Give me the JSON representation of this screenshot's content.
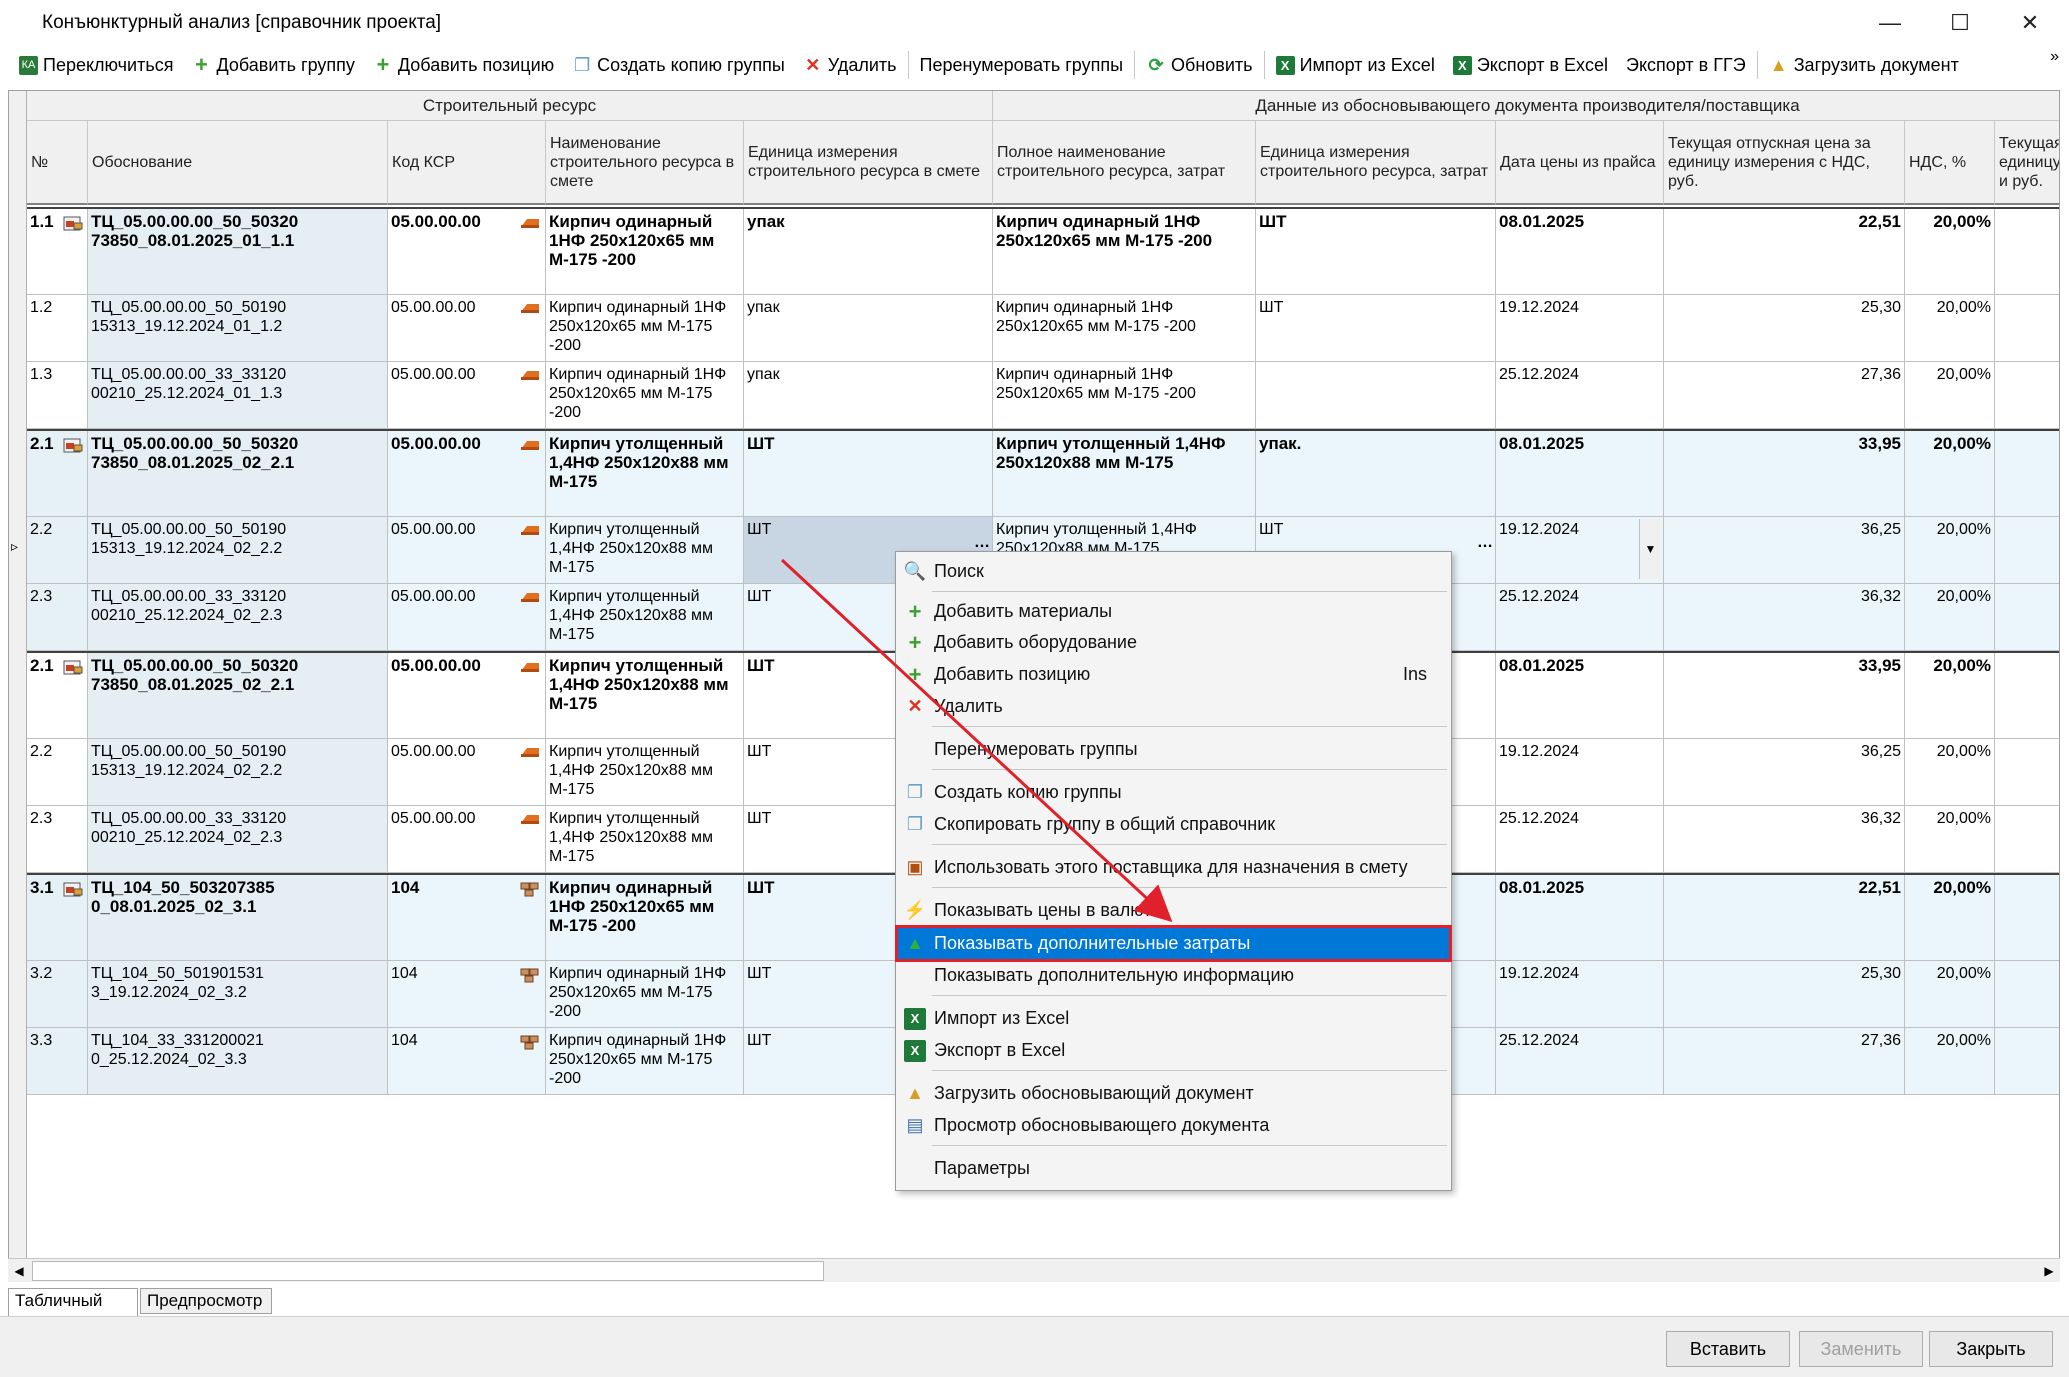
{
  "window": {
    "title": "Конъюнктурный анализ [справочник проекта]"
  },
  "toolbar": {
    "switch": "Переключиться",
    "add_group": "Добавить группу",
    "add_position": "Добавить позицию",
    "copy_group": "Создать копию группы",
    "delete": "Удалить",
    "renumber": "Перенумеровать группы",
    "refresh": "Обновить",
    "import_excel": "Импорт из Excel",
    "export_excel": "Экспорт в Excel",
    "export_gge": "Экспорт в ГГЭ",
    "load_doc": "Загрузить документ",
    "more": "»"
  },
  "grid": {
    "bands": {
      "resource": "Строительный ресурс",
      "doc_data": "Данные из обосновывающего документа производителя/поставщика"
    },
    "columns": {
      "num": "№",
      "basis": "Обоснование",
      "ksr": "Код КСР",
      "name": "Наименование строительного ресурса в смете",
      "unit": "Единица измерения строительного ресурса в смете",
      "fullname": "Полное наименование строительного ресурса, затрат",
      "unit2": "Единица измерения строительного ресурса, затрат",
      "date": "Дата цены из прайса",
      "price": "Текущая отпускная цена за единицу измерения с НДС, руб.",
      "vat": "НДС, %",
      "cur": "Текущая единицу и руб."
    },
    "rows": [
      {
        "num": "1.1",
        "basis": "ТЦ_05.00.00.00_50_50320 73850_08.01.2025_01_1.1",
        "ksr": "05.00.00.00",
        "name": "Кирпич одинарный 1НФ 250х120х65 мм М-175 -200",
        "unit": "упак",
        "fullname": "Кирпич одинарный 1НФ 250х120х65 мм М-175 -200",
        "unit2": "ШТ",
        "date": "08.01.2025",
        "price": "22,51",
        "vat": "20,00%"
      },
      {
        "num": "1.2",
        "basis": "ТЦ_05.00.00.00_50_50190 15313_19.12.2024_01_1.2",
        "ksr": "05.00.00.00",
        "name": "Кирпич одинарный 1НФ 250х120х65 мм М-175 -200",
        "unit": "упак",
        "fullname": "Кирпич одинарный 1НФ 250х120х65 мм М-175 -200",
        "unit2": "ШТ",
        "date": "19.12.2024",
        "price": "25,30",
        "vat": "20,00%"
      },
      {
        "num": "1.3",
        "basis": "ТЦ_05.00.00.00_33_33120 00210_25.12.2024_01_1.3",
        "ksr": "05.00.00.00",
        "name": "Кирпич одинарный 1НФ 250х120х65 мм М-175 -200",
        "unit": "упак",
        "fullname": "Кирпич одинарный 1НФ 250х120х65 мм М-175 -200",
        "unit2": "",
        "date": "25.12.2024",
        "price": "27,36",
        "vat": "20,00%"
      },
      {
        "num": "2.1",
        "basis": "ТЦ_05.00.00.00_50_50320 73850_08.01.2025_02_2.1",
        "ksr": "05.00.00.00",
        "name": "Кирпич утолщенный 1,4НФ 250х120х88 мм М-175",
        "unit": "ШТ",
        "fullname": "Кирпич утолщенный 1,4НФ 250х120х88 мм М-175",
        "unit2": "упак.",
        "date": "08.01.2025",
        "price": "33,95",
        "vat": "20,00%"
      },
      {
        "num": "2.2",
        "basis": "ТЦ_05.00.00.00_50_50190 15313_19.12.2024_02_2.2",
        "ksr": "05.00.00.00",
        "name": "Кирпич утолщенный 1,4НФ 250х120х88 мм М-175",
        "unit": "ШТ",
        "fullname": "Кирпич утолщенный 1,4НФ 250х120х88 мм М-175",
        "unit2": "ШТ",
        "date": "19.12.2024",
        "price": "36,25",
        "vat": "20,00%"
      },
      {
        "num": "2.3",
        "basis": "ТЦ_05.00.00.00_33_33120 00210_25.12.2024_02_2.3",
        "ksr": "05.00.00.00",
        "name": "Кирпич утолщенный 1,4НФ 250х120х88 мм М-175",
        "unit": "ШТ",
        "fullname": "",
        "unit2": "",
        "date": "25.12.2024",
        "price": "36,32",
        "vat": "20,00%"
      },
      {
        "num": "2.1",
        "basis": "ТЦ_05.00.00.00_50_50320 73850_08.01.2025_02_2.1",
        "ksr": "05.00.00.00",
        "name": "Кирпич утолщенный 1,4НФ 250х120х88 мм М-175",
        "unit": "ШТ",
        "fullname": "",
        "unit2": "",
        "date": "08.01.2025",
        "price": "33,95",
        "vat": "20,00%"
      },
      {
        "num": "2.2",
        "basis": "ТЦ_05.00.00.00_50_50190 15313_19.12.2024_02_2.2",
        "ksr": "05.00.00.00",
        "name": "Кирпич утолщенный 1,4НФ 250х120х88 мм М-175",
        "unit": "ШТ",
        "fullname": "",
        "unit2": "",
        "date": "19.12.2024",
        "price": "36,25",
        "vat": "20,00%"
      },
      {
        "num": "2.3",
        "basis": "ТЦ_05.00.00.00_33_33120 00210_25.12.2024_02_2.3",
        "ksr": "05.00.00.00",
        "name": "Кирпич утолщенный 1,4НФ 250х120х88 мм М-175",
        "unit": "ШТ",
        "fullname": "",
        "unit2": "",
        "date": "25.12.2024",
        "price": "36,32",
        "vat": "20,00%"
      },
      {
        "num": "3.1",
        "basis": "ТЦ_104_50_503207385 0_08.01.2025_02_3.1",
        "ksr": "104",
        "name": "Кирпич одинарный 1НФ 250х120х65 мм М-175 -200",
        "unit": "ШТ",
        "fullname": "",
        "unit2": "",
        "date": "08.01.2025",
        "price": "22,51",
        "vat": "20,00%"
      },
      {
        "num": "3.2",
        "basis": "ТЦ_104_50_501901531 3_19.12.2024_02_3.2",
        "ksr": "104",
        "name": "Кирпич одинарный 1НФ 250х120х65 мм М-175 -200",
        "unit": "ШТ",
        "fullname": "",
        "unit2": "",
        "date": "19.12.2024",
        "price": "25,30",
        "vat": "20,00%"
      },
      {
        "num": "3.3",
        "basis": "ТЦ_104_33_331200021 0_25.12.2024_02_3.3",
        "ksr": "104",
        "name": "Кирпич одинарный 1НФ 250х120х65 мм М-175 -200",
        "unit": "ШТ",
        "fullname": "",
        "unit2": "",
        "date": "25.12.2024",
        "price": "27,36",
        "vat": "20,00%"
      }
    ]
  },
  "context_menu": {
    "search": "Поиск",
    "add_materials": "Добавить материалы",
    "add_equipment": "Добавить оборудование",
    "add_position": "Добавить позицию",
    "add_position_key": "Ins",
    "delete": "Удалить",
    "renumber": "Перенумеровать группы",
    "copy_group": "Создать копию группы",
    "copy_to_common": "Скопировать группу в общий справочник",
    "use_supplier": "Использовать этого поставщика для назначения в смету",
    "show_currency": "Показывать цены в валюте",
    "show_extra_costs": "Показывать дополнительные затраты",
    "show_extra_info": "Показывать дополнительную информацию",
    "import_excel": "Импорт из Excel",
    "export_excel": "Экспорт в Excel",
    "load_doc": "Загрузить обосновывающий документ",
    "view_doc": "Просмотр обосновывающего документа",
    "params": "Параметры"
  },
  "tabs": {
    "table": "Табличный вид",
    "preview": "Предпросмотр"
  },
  "footer": {
    "insert": "Вставить",
    "replace": "Заменить",
    "close": "Закрыть"
  },
  "colors": {
    "group_bg": "#eaf6fb",
    "alt_bg": "#ffffff",
    "highlight": "#0078d7",
    "highlight_border": "#e0202a",
    "arrow": "#e0202a"
  }
}
